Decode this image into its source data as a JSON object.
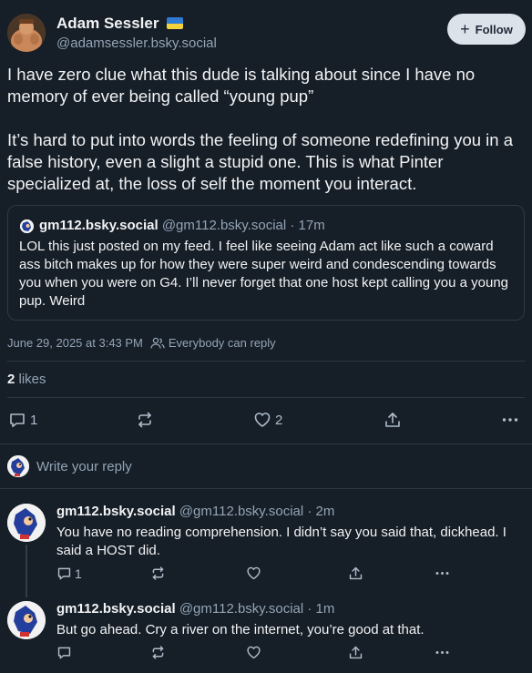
{
  "author": {
    "name": "Adam Sessler",
    "flag": "🇺🇦",
    "handle": "@adamsessler.bsky.social",
    "follow_label": "Follow"
  },
  "post": {
    "paragraphs": [
      "I have zero clue what this dude is talking about since I have no memory of ever being called “young pup”",
      "It’s hard to put into words the feeling of someone redefining you in a false history, even a slight a stupid one. This is what Pinter specialized at, the loss of self the moment you interact."
    ],
    "timestamp": "June 29, 2025 at 3:43 PM",
    "reply_setting": "Everybody can reply",
    "likes_count": "2",
    "likes_label": "likes",
    "actions": {
      "reply_count": "1",
      "like_count": "2"
    }
  },
  "quote": {
    "name": "gm112.bsky.social",
    "handle": "@gm112.bsky.social",
    "time": "· 17m",
    "text": "LOL this just posted on my feed. I feel like seeing Adam act like such a coward ass bitch makes up for how they were super weird and condescending towards you when you were on G4. I’ll never forget that one host kept calling you a young pup. Weird"
  },
  "reply_box": {
    "placeholder": "Write your reply"
  },
  "replies": [
    {
      "name": "gm112.bsky.social",
      "handle": "@gm112.bsky.social",
      "time": "· 2m",
      "text": "You have no reading comprehension. I didn’t say you said that, dickhead. I said a HOST did.",
      "reply_count": "1"
    },
    {
      "name": "gm112.bsky.social",
      "handle": "@gm112.bsky.social",
      "time": "· 1m",
      "text": "But go ahead. Cry a river on the internet, you’re good at that.",
      "reply_count": ""
    }
  ],
  "colors": {
    "background": "#161e27",
    "text": "#f1f3f5",
    "muted": "#93a5b7",
    "border": "#2b3744",
    "follow_bg": "#dce2ea",
    "flag_blue": "#2f7bd6",
    "flag_yellow": "#f4d33a"
  },
  "icons": [
    "plus-icon",
    "people-icon",
    "reply-icon",
    "repost-icon",
    "heart-icon",
    "share-icon",
    "more-icon"
  ]
}
